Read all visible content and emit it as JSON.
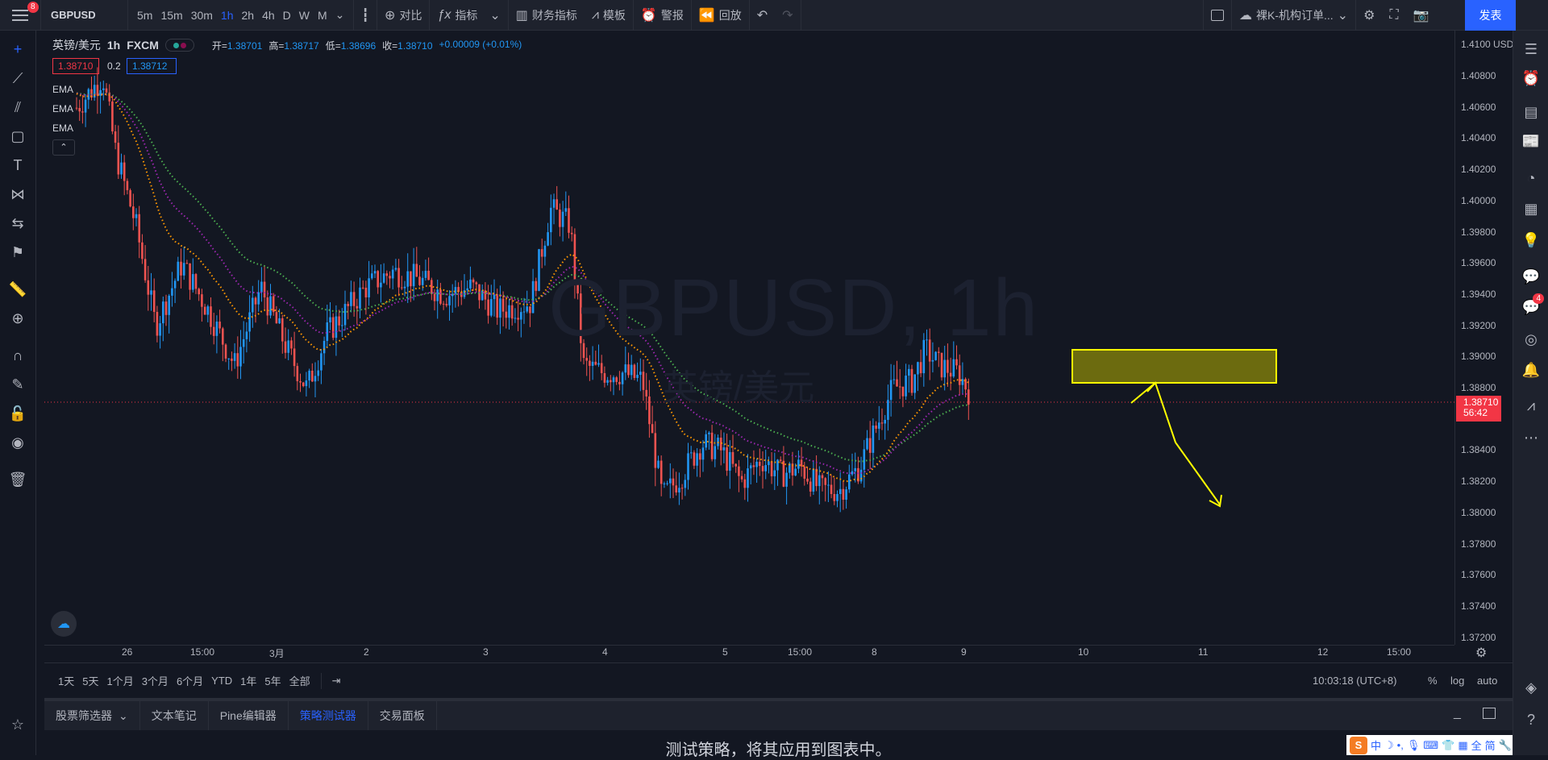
{
  "topbar": {
    "menu_badge": "8",
    "symbol": "GBPUSD",
    "intervals": [
      "5m",
      "15m",
      "30m",
      "1h",
      "2h",
      "4h",
      "D",
      "W",
      "M"
    ],
    "active_interval": "1h",
    "compare_label": "对比",
    "indicators_label": "指标",
    "financials_label": "财务指标",
    "templates_label": "模板",
    "alert_label": "警报",
    "replay_label": "回放",
    "layout_name": "裸K-机构订单...",
    "publish_label": "发表"
  },
  "legend": {
    "name": "英镑/美元",
    "timeframe": "1h",
    "source": "FXCM",
    "open_label": "开=",
    "open": "1.38701",
    "high_label": "高=",
    "high": "1.38717",
    "low_label": "低=",
    "low": "1.38696",
    "close_label": "收=",
    "close": "1.38710",
    "change": "+0.00009 (+0.01%)",
    "bid": "1.38710",
    "spread": "0.2",
    "ask": "1.38712",
    "ema_labels": [
      "EMA",
      "EMA",
      "EMA"
    ]
  },
  "watermark": {
    "symbol": "GBPUSD, 1h",
    "name": "英镑/美元"
  },
  "yaxis": {
    "currency": "USD",
    "top_label": "1.4100",
    "ticks": [
      "1.40800",
      "1.40600",
      "1.40400",
      "1.40200",
      "1.40000",
      "1.39800",
      "1.39600",
      "1.39400",
      "1.39200",
      "1.39000",
      "1.38800",
      "1.38400",
      "1.38200",
      "1.38000",
      "1.37800",
      "1.37600",
      "1.37400",
      "1.37200"
    ],
    "current_price": "1.38710",
    "countdown": "56:42"
  },
  "xaxis": {
    "ticks": [
      "26",
      "15:00",
      "3月",
      "2",
      "3",
      "4",
      "5",
      "15:00",
      "8",
      "9",
      "10",
      "11",
      "12",
      "15:00"
    ]
  },
  "ranges": {
    "items": [
      "1天",
      "5天",
      "1个月",
      "3个月",
      "6个月",
      "YTD",
      "1年",
      "5年",
      "全部"
    ],
    "time": "10:03:18 (UTC+8)",
    "percent": "%",
    "log": "log",
    "auto": "auto"
  },
  "panel": {
    "tabs": [
      "股票筛选器",
      "文本笔记",
      "Pine编辑器",
      "策略测试器",
      "交易面板"
    ],
    "active": "策略测试器",
    "message": "测试策略，将其应用到图表中。"
  },
  "rightbar": {
    "badge": "4"
  },
  "ime": {
    "label": "中"
  },
  "chart_data": {
    "type": "candlestick",
    "symbol": "GBPUSD",
    "interval": "1h",
    "ylim": [
      1.372,
      1.41
    ],
    "last": 1.3871,
    "ema_colors": [
      "#4caf50",
      "#9c27b0",
      "#ff9800"
    ],
    "up_color": "#2196f3",
    "down_color": "#ef5350",
    "zone": {
      "y_top": 1.3905,
      "y_bottom": 1.3883,
      "color": "#ffff00"
    }
  }
}
